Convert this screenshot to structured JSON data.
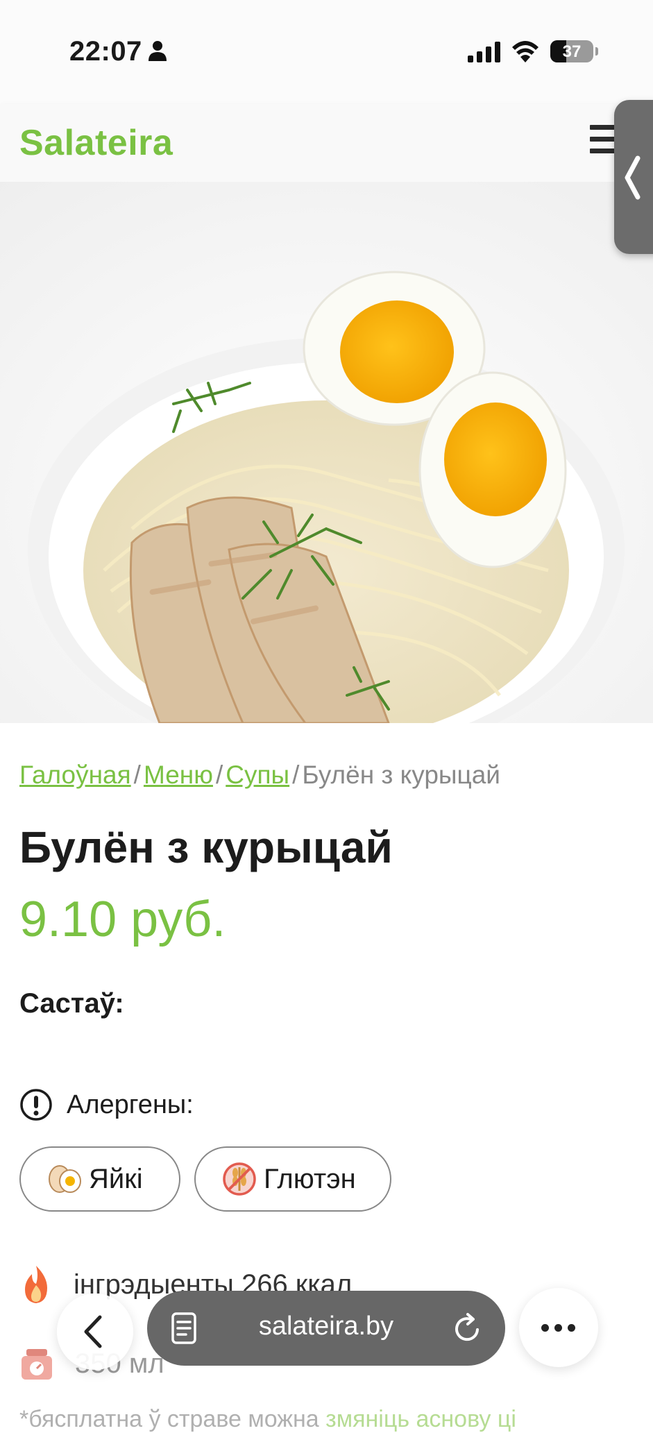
{
  "status_bar": {
    "time": "22:07",
    "battery": "37"
  },
  "header": {
    "logo": "Salateira"
  },
  "breadcrumb": {
    "items": [
      "Галоўная",
      "Меню",
      "Супы"
    ],
    "current": "Булён з курыцай",
    "separator": "/"
  },
  "product": {
    "title": "Булён з курыцай",
    "price": "9.10 руб.",
    "composition_label": "Састаў:",
    "allergens_label": "Алергены:",
    "allergens": [
      "Яйкі",
      "Глютэн"
    ],
    "nutrition": "інгрэдыенты 266 ккал",
    "volume": "350 мл",
    "note_prefix": "*бясплатна ў страве можна",
    "note_link": "змяніць аснову ці"
  },
  "browser_bar": {
    "url": "salateira.by"
  },
  "colors": {
    "brand_green": "#7ac143",
    "url_pill": "#676767"
  },
  "icons": [
    "person-icon",
    "signal-icon",
    "wifi-icon",
    "battery-icon",
    "menu-icon",
    "collapse-tab-icon",
    "alert-icon",
    "egg-icon",
    "gluten-icon",
    "fire-icon",
    "scale-icon",
    "back-icon",
    "reader-icon",
    "reload-icon",
    "more-icon"
  ]
}
